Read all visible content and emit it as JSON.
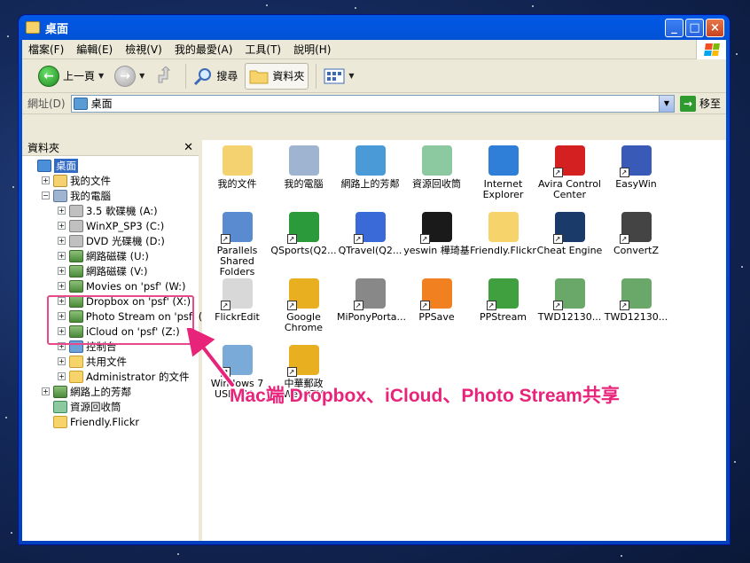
{
  "window": {
    "title": "桌面",
    "buttons": [
      "_",
      "□",
      "×"
    ]
  },
  "menubar": [
    "檔案(F)",
    "編輯(E)",
    "檢視(V)",
    "我的最愛(A)",
    "工具(T)",
    "說明(H)"
  ],
  "toolbar": {
    "back_label": "上一頁",
    "search_label": "搜尋",
    "folders_label": "資料夾"
  },
  "address": {
    "label": "網址(D)",
    "value": "桌面",
    "go_label": "移至"
  },
  "folderpane": {
    "header": "資料夾",
    "close": "✕",
    "tree": [
      {
        "label": "桌面",
        "level": 0,
        "exp": "",
        "icon": "desktop",
        "selected": true
      },
      {
        "label": "我的文件",
        "level": 1,
        "exp": "+",
        "icon": "docs"
      },
      {
        "label": "我的電腦",
        "level": 1,
        "exp": "−",
        "icon": "pc"
      },
      {
        "label": "3.5 軟碟機 (A:)",
        "level": 2,
        "exp": "+",
        "icon": "drive"
      },
      {
        "label": "WinXP_SP3 (C:)",
        "level": 2,
        "exp": "+",
        "icon": "drive"
      },
      {
        "label": "DVD 光碟機 (D:)",
        "level": 2,
        "exp": "+",
        "icon": "drive"
      },
      {
        "label": "網路磁碟 (U:)",
        "level": 2,
        "exp": "+",
        "icon": "net"
      },
      {
        "label": "網路磁碟 (V:)",
        "level": 2,
        "exp": "+",
        "icon": "net"
      },
      {
        "label": "Movies on 'psf' (W:)",
        "level": 2,
        "exp": "+",
        "icon": "net"
      },
      {
        "label": "Dropbox on 'psf' (X:)",
        "level": 2,
        "exp": "+",
        "icon": "net"
      },
      {
        "label": "Photo Stream on 'psf' (Y:)",
        "level": 2,
        "exp": "+",
        "icon": "net"
      },
      {
        "label": "iCloud on 'psf' (Z:)",
        "level": 2,
        "exp": "+",
        "icon": "net"
      },
      {
        "label": "控制台",
        "level": 2,
        "exp": "+",
        "icon": "ctrl"
      },
      {
        "label": "共用文件",
        "level": 2,
        "exp": "+",
        "icon": "folder"
      },
      {
        "label": "Administrator 的文件",
        "level": 2,
        "exp": "+",
        "icon": "folder"
      },
      {
        "label": "網路上的芳鄰",
        "level": 1,
        "exp": "+",
        "icon": "net"
      },
      {
        "label": "資源回收筒",
        "level": 1,
        "exp": "",
        "icon": "recycle"
      },
      {
        "label": "Friendly.Flickr",
        "level": 1,
        "exp": "",
        "icon": "folder"
      }
    ]
  },
  "desktop_icons": [
    {
      "label": "我的文件",
      "color": "#f4d270",
      "shortcut": false
    },
    {
      "label": "我的電腦",
      "color": "#9fb4d0",
      "shortcut": false
    },
    {
      "label": "網路上的芳鄰",
      "color": "#4b9ad8",
      "shortcut": false
    },
    {
      "label": "資源回收筒",
      "color": "#8cc8a0",
      "shortcut": false
    },
    {
      "label": "Internet Explorer",
      "color": "#2f7ed8",
      "shortcut": false
    },
    {
      "label": "Avira Control Center",
      "color": "#d42020",
      "shortcut": true
    },
    {
      "label": "EasyWin",
      "color": "#3a5ab8",
      "shortcut": true
    },
    {
      "label": "Parallels Shared Folders",
      "color": "#5a8ad0",
      "shortcut": true
    },
    {
      "label": "QSports(Q2...",
      "color": "#2a9a3a",
      "shortcut": true
    },
    {
      "label": "QTravel(Q2...",
      "color": "#3a6ad8",
      "shortcut": true
    },
    {
      "label": "yeswin 樺琦基",
      "color": "#1a1a1a",
      "shortcut": true
    },
    {
      "label": "Friendly.Flickr",
      "color": "#f7d46b",
      "shortcut": false
    },
    {
      "label": "Cheat Engine",
      "color": "#1a3a6a",
      "shortcut": true
    },
    {
      "label": "ConvertZ",
      "color": "#444444",
      "shortcut": true
    },
    {
      "label": "FlickrEdit",
      "color": "#d8d8d8",
      "shortcut": true
    },
    {
      "label": "Google Chrome",
      "color": "#e8b020",
      "shortcut": true
    },
    {
      "label": "MiPonyPorta...",
      "color": "#888888",
      "shortcut": true
    },
    {
      "label": "PPSave",
      "color": "#f08020",
      "shortcut": true
    },
    {
      "label": "PPStream",
      "color": "#40a040",
      "shortcut": true
    },
    {
      "label": "TWD12130...",
      "color": "#6aa86a",
      "shortcut": true
    },
    {
      "label": "TWD12130...",
      "color": "#6aa86a",
      "shortcut": true
    },
    {
      "label": "Windows 7 USB DV...",
      "color": "#7aaad8",
      "shortcut": true
    },
    {
      "label": "中華郵政 WebATM",
      "color": "#e8b020",
      "shortcut": true
    }
  ],
  "annotation": {
    "text": "Mac端 Dropbox、iCloud、Photo Stream共享",
    "color": "#e8237a"
  }
}
